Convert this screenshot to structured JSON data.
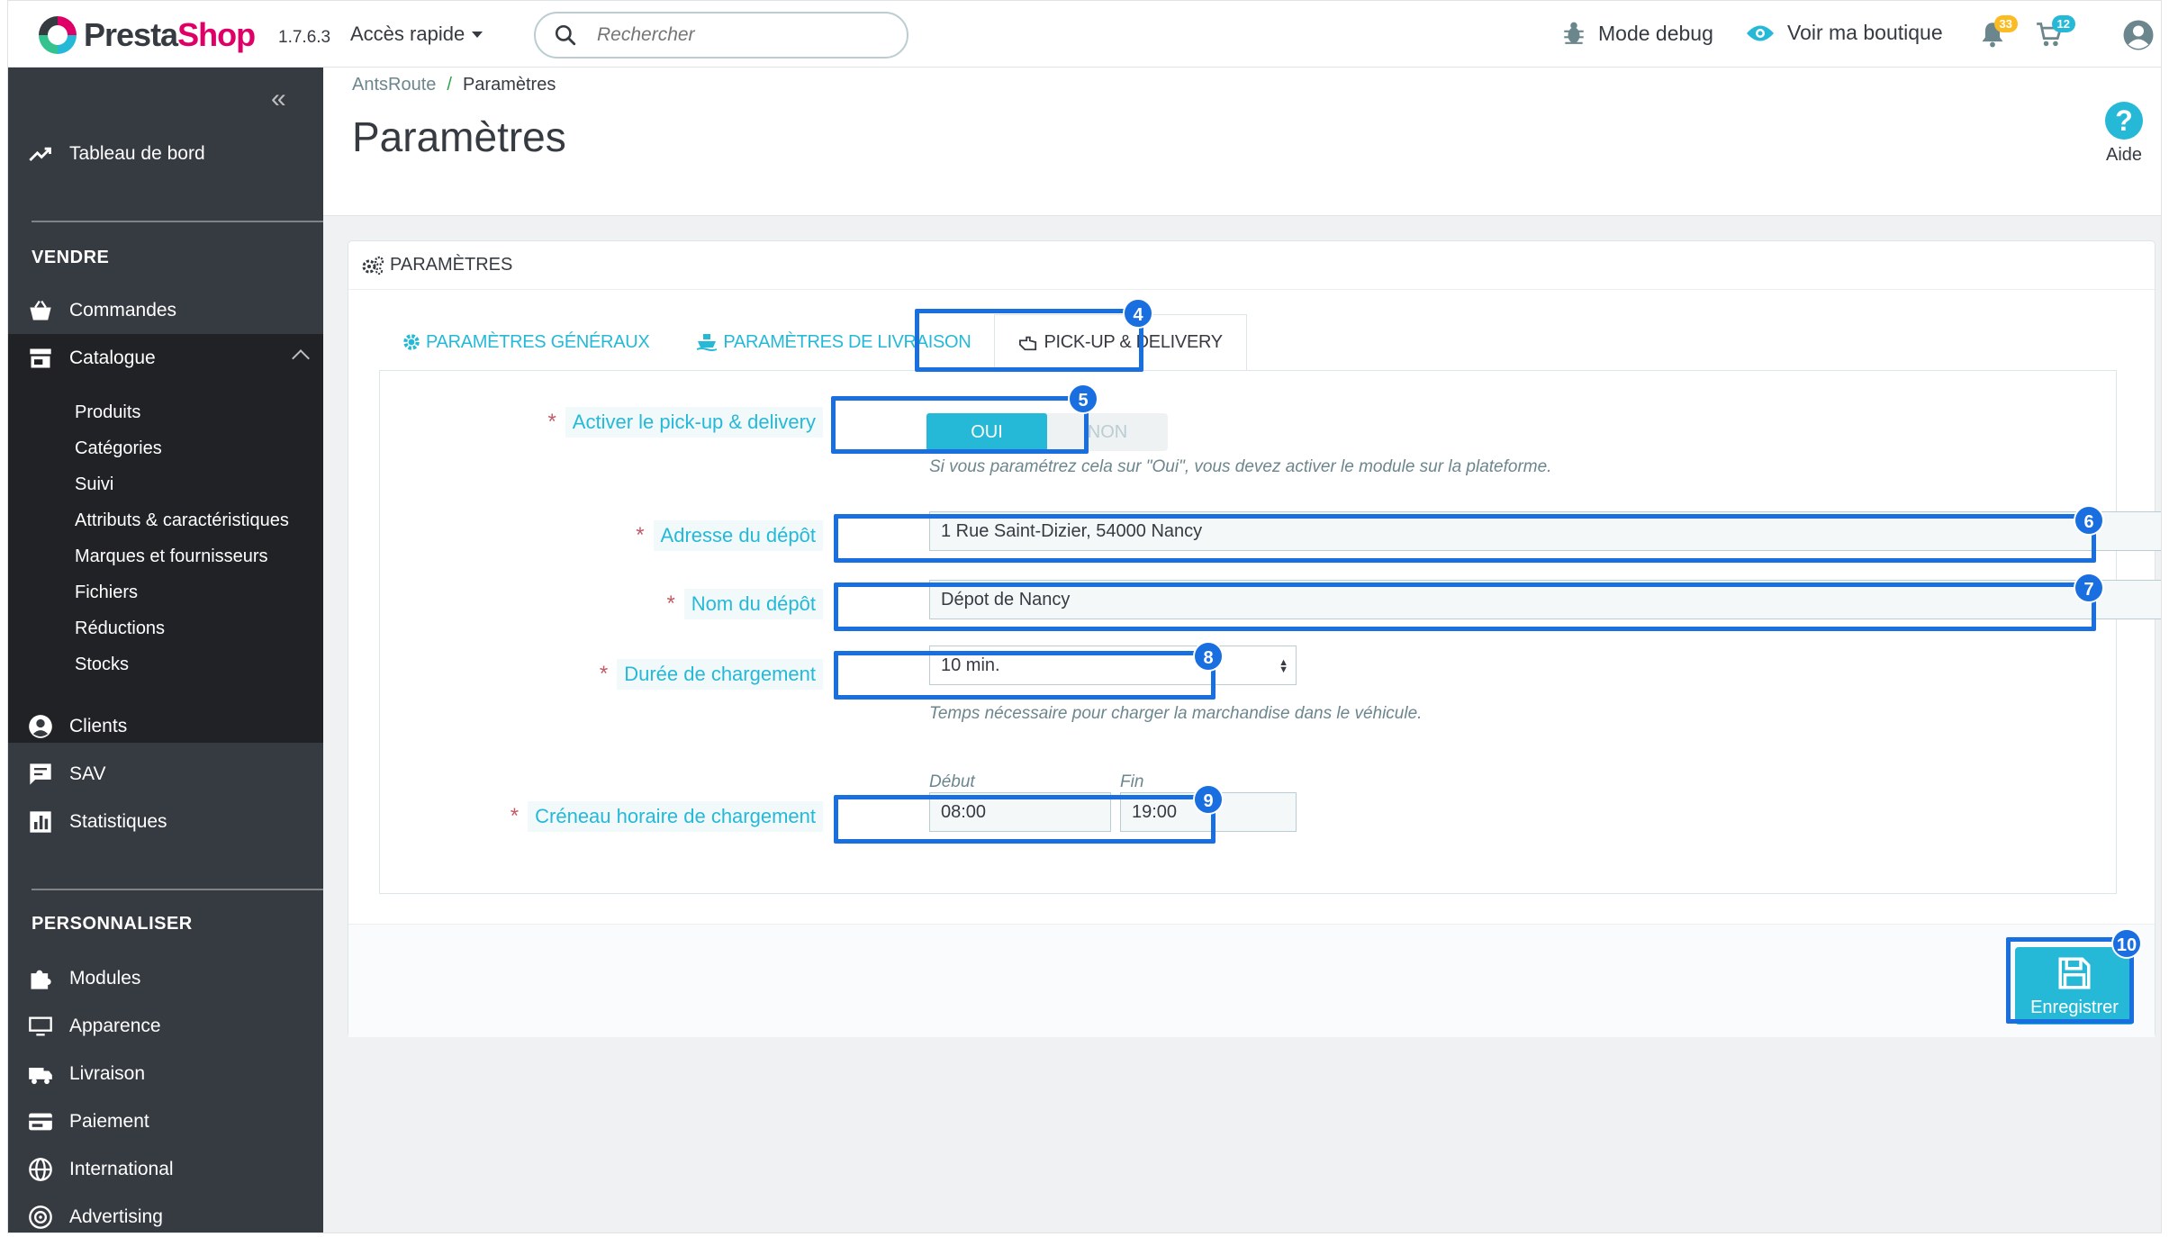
{
  "header": {
    "logo_prefix": "Presta",
    "logo_suffix": "Shop",
    "version": "1.7.6.3",
    "quick_access": "Accès rapide",
    "search_placeholder": "Rechercher",
    "mode_debug": "Mode debug",
    "view_shop": "Voir ma boutique",
    "notifications_count": "33",
    "orders_count": "12"
  },
  "sidebar": {
    "dashboard": "Tableau de bord",
    "section_sell": "VENDRE",
    "orders": "Commandes",
    "catalogue": "Catalogue",
    "catalogue_sub": [
      "Produits",
      "Catégories",
      "Suivi",
      "Attributs & caractéristiques",
      "Marques et fournisseurs",
      "Fichiers",
      "Réductions",
      "Stocks"
    ],
    "customers": "Clients",
    "support": "SAV",
    "stats": "Statistiques",
    "section_customize": "PERSONNALISER",
    "modules": "Modules",
    "appearance": "Apparence",
    "shipping": "Livraison",
    "payment": "Paiement",
    "international": "International",
    "advertising": "Advertising"
  },
  "page": {
    "breadcrumb_parent": "AntsRoute",
    "breadcrumb_sep": "/",
    "breadcrumb_current": "Paramètres",
    "title": "Paramètres",
    "help": "Aide"
  },
  "panel": {
    "heading": "PARAMÈTRES",
    "tabs": [
      "PARAMÈTRES GÉNÉRAUX",
      "PARAMÈTRES DE LIVRAISON",
      "PICK-UP & DELIVERY"
    ],
    "active_tab": 2,
    "fields": {
      "pickup_label": "Activer le pick-up & delivery",
      "pickup_on": "OUI",
      "pickup_off": "NON",
      "pickup_help": "Si vous paramétrez cela sur \"Oui\", vous devez activer le module sur la plateforme.",
      "address_label": "Adresse du dépôt",
      "address_value": "1 Rue Saint-Dizier, 54000 Nancy",
      "depot_name_label": "Nom du dépôt",
      "depot_name_value": "Dépot de Nancy",
      "loading_time_label": "Durée de chargement",
      "loading_time_value": "10 min.",
      "loading_time_help": "Temps nécessaire pour charger la marchandise dans le véhicule.",
      "slot_label": "Créneau horaire de chargement",
      "slot_start_label": "Début",
      "slot_end_label": "Fin",
      "slot_start_value": "08:00",
      "slot_end_value": "19:00",
      "required_marker": "*"
    },
    "save": "Enregistrer"
  },
  "annotations": [
    "4",
    "5",
    "6",
    "7",
    "8",
    "9",
    "10"
  ],
  "colors": {
    "accent": "#25b9d7",
    "brand": "#df0067",
    "sidebar": "#363a41",
    "annotation": "#1a6fe0"
  }
}
